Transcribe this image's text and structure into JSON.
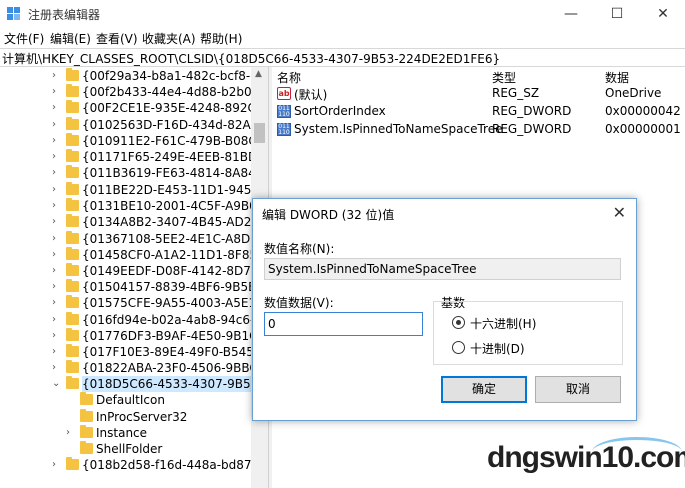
{
  "window": {
    "title": "注册表编辑器",
    "minimize": "—",
    "maximize": "☐",
    "close": "✕"
  },
  "menu": [
    "文件(F)",
    "编辑(E)",
    "查看(V)",
    "收藏夹(A)",
    "帮助(H)"
  ],
  "address": "计算机\\HKEY_CLASSES_ROOT\\CLSID\\{018D5C66-4533-4307-9B53-224DE2ED1FE6}",
  "tree": [
    {
      "label": "{00f29a34-b8a1-482c-bcf8-3ac",
      "arrow": "›"
    },
    {
      "label": "{00f2b433-44e4-4d88-b2b0-2e",
      "arrow": "›"
    },
    {
      "label": "{00F2CE1E-935E-4248-892C-1",
      "arrow": "›"
    },
    {
      "label": "{0102563D-F16D-434d-82A2-3",
      "arrow": "›"
    },
    {
      "label": "{010911E2-F61C-479B-B08C-4",
      "arrow": "›"
    },
    {
      "label": "{01171F65-249E-4EEB-81BD-0",
      "arrow": "›"
    },
    {
      "label": "{011B3619-FE63-4814-8A84-1",
      "arrow": "›"
    },
    {
      "label": "{011BE22D-E453-11D1-945A-0",
      "arrow": "›"
    },
    {
      "label": "{0131BE10-2001-4C5F-A9B0-C",
      "arrow": "›"
    },
    {
      "label": "{0134A8B2-3407-4B45-AD25-E",
      "arrow": "›"
    },
    {
      "label": "{01367108-5EE2-4E1C-A8DE-2",
      "arrow": "›"
    },
    {
      "label": "{01458CF0-A1A2-11D1-8F85-0",
      "arrow": "›"
    },
    {
      "label": "{0149EEDF-D08F-4142-8D73-D",
      "arrow": "›"
    },
    {
      "label": "{01504157-8839-4BF6-9B5B-5",
      "arrow": "›"
    },
    {
      "label": "{01575CFE-9A55-4003-A5E1-F",
      "arrow": "›"
    },
    {
      "label": "{016fd94e-b02a-4ab8-94c6-14",
      "arrow": "›"
    },
    {
      "label": "{01776DF3-B9AF-4E50-9B1C-5",
      "arrow": "›"
    },
    {
      "label": "{017F10E3-89E4-49F0-B545-61",
      "arrow": "›"
    },
    {
      "label": "{01822ABA-23F0-4506-9BBC-6",
      "arrow": "›"
    },
    {
      "label": "{018D5C66-4533-4307-9B53-2",
      "arrow": "⌄"
    },
    {
      "label": "DefaultIcon",
      "arrow": ""
    },
    {
      "label": "InProcServer32",
      "arrow": ""
    },
    {
      "label": "Instance",
      "arrow": "›"
    },
    {
      "label": "ShellFolder",
      "arrow": ""
    },
    {
      "label": "{018b2d58-f16d-448a-bd87-22",
      "arrow": "›"
    }
  ],
  "list": {
    "headers": [
      "名称",
      "类型",
      "数据"
    ],
    "rows": [
      {
        "icon": "string-value-icon",
        "name": "(默认)",
        "type": "REG_SZ",
        "data": "OneDrive"
      },
      {
        "icon": "binary-value-icon",
        "name": "SortOrderIndex",
        "type": "REG_DWORD",
        "data": "0x00000042 (6"
      },
      {
        "icon": "binary-value-icon",
        "name": "System.IsPinnedToNameSpaceTree",
        "type": "REG_DWORD",
        "data": "0x00000001 (1"
      }
    ]
  },
  "dialog": {
    "title": "编辑 DWORD (32 位)值",
    "close": "✕",
    "name_label": "数值名称(N):",
    "name_value": "System.IsPinnedToNameSpaceTree",
    "data_label": "数值数据(V):",
    "data_value": "0",
    "base_label": "基数",
    "radio_hex": "十六进制(H)",
    "radio_dec": "十进制(D)",
    "ok": "确定",
    "cancel": "取消"
  },
  "watermark": "dngswin10.com",
  "colors": {
    "selection": "#cde8ff",
    "accent": "#0078d7",
    "folder": "#f5c342"
  }
}
